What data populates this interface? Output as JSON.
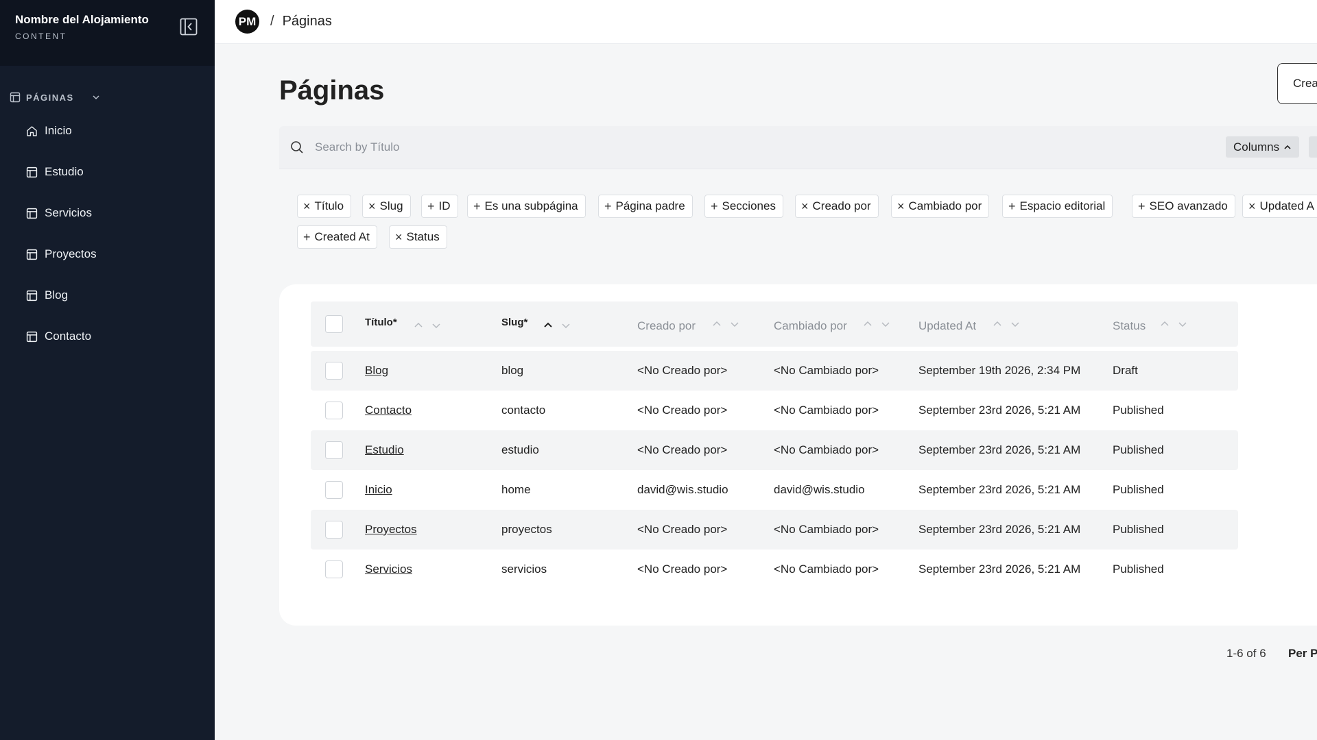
{
  "sidebar": {
    "title": "Nombre del Alojamiento",
    "subtitle": "CONTENT",
    "group_label": "PÁGINAS",
    "items": [
      {
        "label": "Inicio",
        "icon": "home-icon"
      },
      {
        "label": "Estudio",
        "icon": "layout-icon"
      },
      {
        "label": "Servicios",
        "icon": "layout-icon"
      },
      {
        "label": "Proyectos",
        "icon": "layout-icon"
      },
      {
        "label": "Blog",
        "icon": "layout-icon"
      },
      {
        "label": "Contacto",
        "icon": "layout-icon"
      }
    ]
  },
  "topbar": {
    "avatar_initials": "PM",
    "separator": "/",
    "breadcrumb": "Páginas"
  },
  "main": {
    "title": "Páginas",
    "create_label": "Crea",
    "search_placeholder": "Search by Título",
    "columns_label": "Columns"
  },
  "column_chips": [
    {
      "symbol": "×",
      "label": "Título"
    },
    {
      "symbol": "×",
      "label": "Slug"
    },
    {
      "symbol": "+",
      "label": "ID"
    },
    {
      "symbol": "+",
      "label": "Es una subpágina"
    },
    {
      "symbol": "+",
      "label": "Página padre"
    },
    {
      "symbol": "+",
      "label": "Secciones"
    },
    {
      "symbol": "×",
      "label": "Creado por"
    },
    {
      "symbol": "×",
      "label": "Cambiado por"
    },
    {
      "symbol": "+",
      "label": "Espacio editorial"
    },
    {
      "symbol": "+",
      "label": "SEO avanzado"
    },
    {
      "symbol": "×",
      "label": "Updated A"
    },
    {
      "symbol": "+",
      "label": "Created At"
    },
    {
      "symbol": "×",
      "label": "Status"
    }
  ],
  "table": {
    "headers": [
      "Título*",
      "Slug*",
      "Creado por",
      "Cambiado por",
      "Updated At",
      "Status"
    ],
    "rows": [
      [
        "Blog",
        "blog",
        "<No Creado por>",
        "<No Cambiado por>",
        "September 19th 2026, 2:34 PM",
        "Draft"
      ],
      [
        "Contacto",
        "contacto",
        "<No Creado por>",
        "<No Cambiado por>",
        "September 23rd 2026, 5:21 AM",
        "Published"
      ],
      [
        "Estudio",
        "estudio",
        "<No Creado por>",
        "<No Cambiado por>",
        "September 23rd 2026, 5:21 AM",
        "Published"
      ],
      [
        "Inicio",
        "home",
        "david@wis.studio",
        "david@wis.studio",
        "September 23rd 2026, 5:21 AM",
        "Published"
      ],
      [
        "Proyectos",
        "proyectos",
        "<No Creado por>",
        "<No Cambiado por>",
        "September 23rd 2026, 5:21 AM",
        "Published"
      ],
      [
        "Servicios",
        "servicios",
        "<No Creado por>",
        "<No Cambiado por>",
        "September 23rd 2026, 5:21 AM",
        "Published"
      ]
    ]
  },
  "pagination": {
    "info": "1-6 of 6",
    "per_page_label": "Per P"
  }
}
